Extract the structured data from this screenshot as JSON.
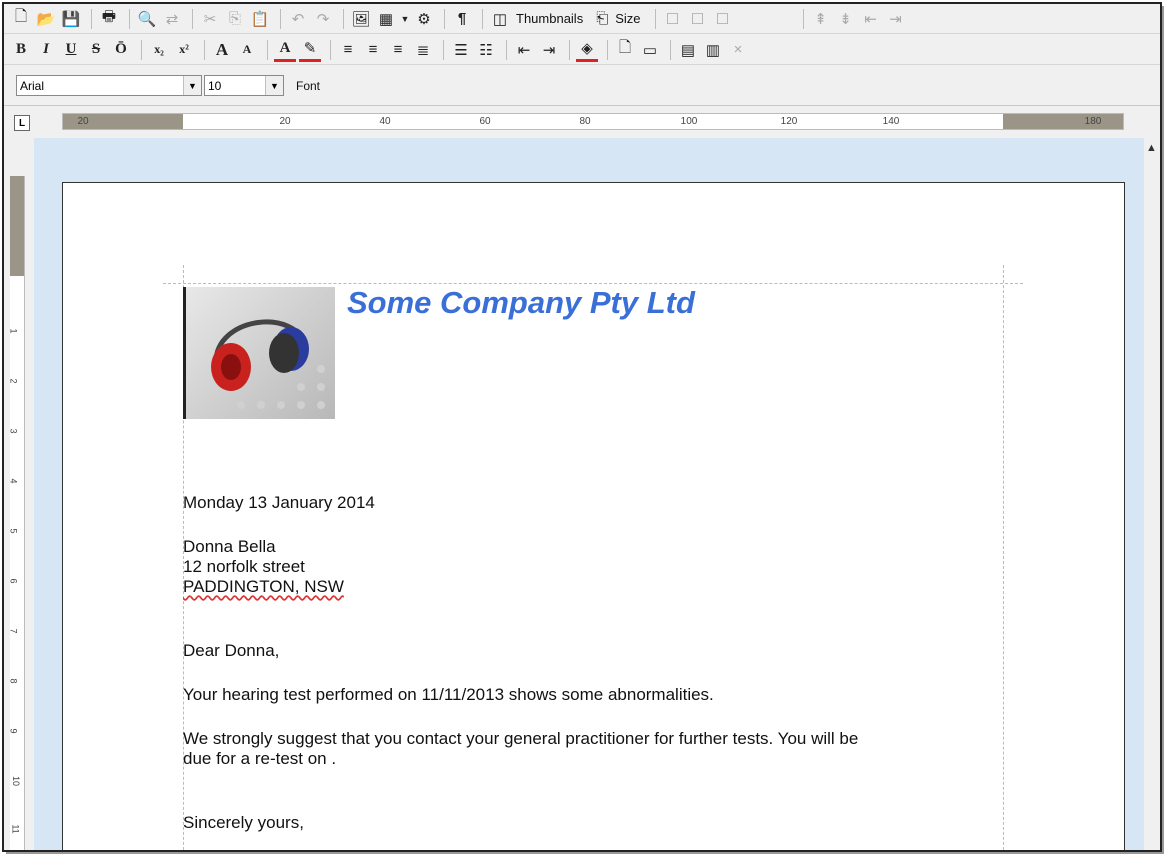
{
  "toolbar1": {
    "thumbnails_label": "Thumbnails",
    "size_label": "Size"
  },
  "toolbar2": {
    "bold_label": "B",
    "italic_label": "I",
    "underline_label": "U",
    "strike_label": "S",
    "overline_label": "Ō",
    "close_label": "×"
  },
  "format_bar": {
    "font_name": "Arial",
    "font_size": "10",
    "font_button": "Font"
  },
  "ruler": {
    "ticks": [
      "20",
      "20",
      "40",
      "60",
      "80",
      "100",
      "120",
      "140",
      "180"
    ],
    "vticks": [
      "1",
      "2",
      "3",
      "4",
      "5",
      "6",
      "7",
      "8",
      "9",
      "10",
      "11"
    ]
  },
  "document": {
    "company": "Some Company Pty Ltd",
    "date": "Monday 13 January 2014",
    "recipient_name": "Donna Bella",
    "address_line1": "12 norfolk street",
    "address_line2": "PADDINGTON,  NSW",
    "salutation": "Dear Donna,",
    "para1": "Your hearing test performed on 11/11/2013 shows some  abnormalities.",
    "para2_line1": "We strongly suggest that you contact your general practitioner for further tests. You will be",
    "para2_line2": "due for a re-test on .",
    "closing": "Sincerely yours,"
  }
}
